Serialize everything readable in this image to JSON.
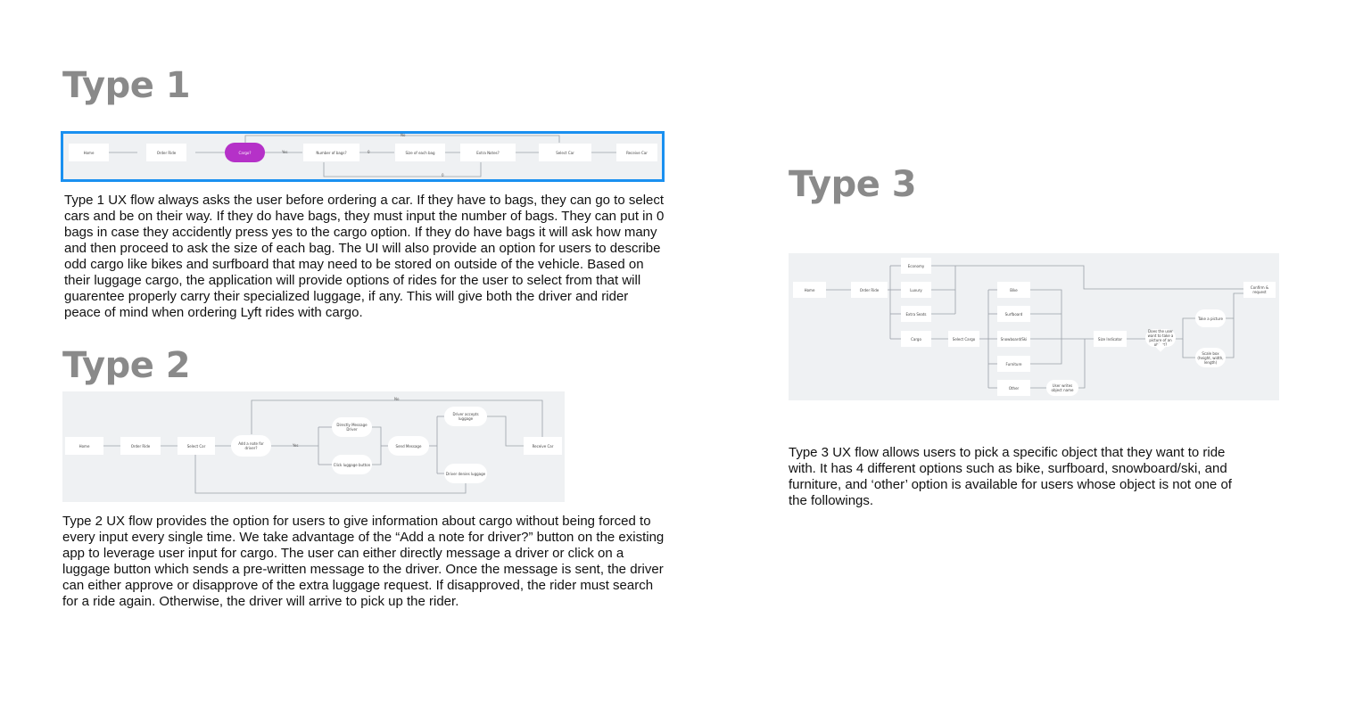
{
  "type1": {
    "heading": "Type 1",
    "nodes": {
      "home": "Home",
      "order_ride": "Order Ride",
      "cargo": "Cargo?",
      "num_bags": "Number of bags?",
      "size_bag": "Size of each bag",
      "extra_notes": "Extra Notes?",
      "select_car": "Select Car",
      "receive_car": "Receive Car"
    },
    "edges": {
      "yes": "Yes",
      "no": "No",
      "zero": "0",
      "top": "No",
      "bottom": "0"
    },
    "description": "Type 1 UX flow always asks the user before ordering a car. If they have to bags, they can go to select cars and be on their way. If they do have bags, they must input the number of bags. They can put in 0 bags in case they accidently press yes to the cargo option. If they do have bags it will ask how many and then proceed to ask the size of each bag. The UI will also provide an option for users to describe odd cargo like bikes and surfboard that may need to be stored on outside of the vehicle. Based on their luggage cargo, the application will provide options of rides for the user to select from that will guarentee properly carry their specialized luggage, if any. This will give both the driver and rider peace of mind when ordering Lyft rides with cargo."
  },
  "type2": {
    "heading": "Type 2",
    "nodes": {
      "home": "Home",
      "order_ride": "Order Ride",
      "select_car": "Select Car",
      "add_note": "Add a note for driver?",
      "direct_msg": "Directly Message Driver",
      "click_luggage": "Click luggage button",
      "send_msg": "Send Message",
      "accepts": "Driver accepts luggage",
      "denies": "Driver denies luggage",
      "receive_car": "Receive Car"
    },
    "edges": {
      "yes": "Yes",
      "no": "No"
    },
    "description": "Type 2 UX flow provides the option for users to give information about cargo without being forced to every input every single time. We take advantage of the “Add a note for driver?” button on the existing app to leverage user input for cargo. The user can either directly message a driver or click on a luggage button which sends a pre-written message to the driver. Once the message is sent, the driver can either approve or disapprove of the  extra luggage request. If disapproved, the rider must search for a ride again. Otherwise, the driver will arrive to pick up the rider."
  },
  "type3": {
    "heading": "Type 3",
    "nodes": {
      "home": "Home",
      "order_ride": "Order Ride",
      "economy": "Economy",
      "luxury": "Luxury",
      "extra_seats": "Extra Seats",
      "cargo": "Cargo",
      "select_cargo": "Select Cargo",
      "bike": "Bike",
      "surfboard": "Surfboard",
      "snowboard": "Snowboard/Ski",
      "furniture": "Furniture",
      "other": "Other",
      "user_writes": "User writes object name",
      "size_indicator": "Size Indicator",
      "question": "Does the user want to take a picture of an object?",
      "take_picture": "Take a picture",
      "scale_box": "Scale box (height, width, length)",
      "confirm": "Confirm & request"
    },
    "description": "Type 3 UX flow allows users to pick a specific object that they want to ride with. It has 4 different options such as bike, surfboard, snowboard/ski, and furniture, and ‘other’ option is available for users whose object is not one of the followings."
  }
}
